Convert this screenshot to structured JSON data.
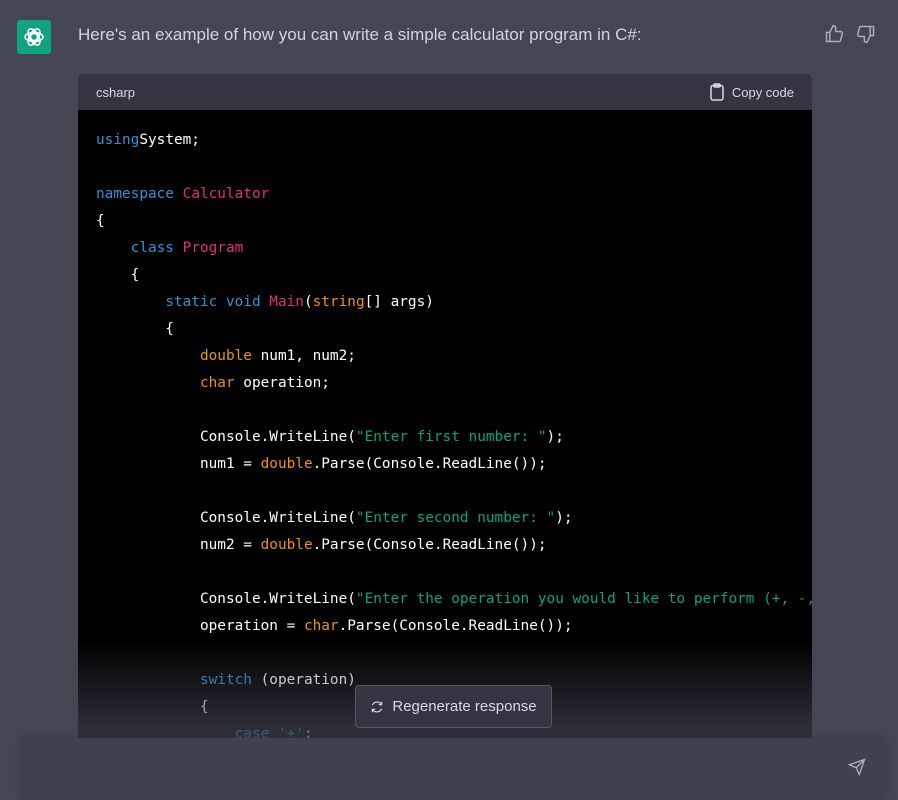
{
  "message": {
    "text": "Here's an example of how you can write a simple calculator program in C#:"
  },
  "code_block": {
    "language": "csharp",
    "copy_label": "Copy code",
    "lines": [
      [
        [
          "k",
          "using"
        ],
        [
          "",
          "System;"
        ]
      ],
      [],
      [
        [
          "k",
          "namespace"
        ],
        [
          "",
          ""
        ],
        [
          "t",
          "Calculator"
        ]
      ],
      [
        [
          "",
          "{"
        ]
      ],
      [
        [
          "",
          "    "
        ],
        [
          "k",
          "class"
        ],
        [
          "",
          ""
        ],
        [
          "t",
          "Program"
        ]
      ],
      [
        [
          "",
          "    {"
        ]
      ],
      [
        [
          "",
          "        "
        ],
        [
          "k",
          "static"
        ],
        [
          "",
          ""
        ],
        [
          "k",
          "void"
        ],
        [
          "",
          ""
        ],
        [
          "t",
          "Main"
        ],
        [
          "",
          "("
        ],
        [
          "o",
          "string"
        ],
        [
          "",
          "[] args)"
        ]
      ],
      [
        [
          "",
          "        {"
        ]
      ],
      [
        [
          "",
          "            "
        ],
        [
          "o",
          "double"
        ],
        [
          "",
          ""
        ],
        [
          "",
          "num1, num2;"
        ]
      ],
      [
        [
          "",
          "            "
        ],
        [
          "o",
          "char"
        ],
        [
          "",
          ""
        ],
        [
          "",
          "operation;"
        ]
      ],
      [],
      [
        [
          "",
          "            Console.WriteLine("
        ],
        [
          "s",
          "\"Enter first number: \""
        ],
        [
          "",
          ");"
        ]
      ],
      [
        [
          "",
          "            num1 = "
        ],
        [
          "o",
          "double"
        ],
        [
          "",
          ".Parse(Console.ReadLine());"
        ]
      ],
      [],
      [
        [
          "",
          "            Console.WriteLine("
        ],
        [
          "s",
          "\"Enter second number: \""
        ],
        [
          "",
          ");"
        ]
      ],
      [
        [
          "",
          "            num2 = "
        ],
        [
          "o",
          "double"
        ],
        [
          "",
          ".Parse(Console.ReadLine());"
        ]
      ],
      [],
      [
        [
          "",
          "            Console.WriteLine("
        ],
        [
          "s",
          "\"Enter the operation you would like to perform (+, -, *, /): \""
        ],
        [
          "",
          ");"
        ]
      ],
      [
        [
          "",
          "            operation = "
        ],
        [
          "o",
          "char"
        ],
        [
          "",
          ".Parse(Console.ReadLine());"
        ]
      ],
      [],
      [
        [
          "",
          "            "
        ],
        [
          "k",
          "switch"
        ],
        [
          "",
          ""
        ],
        [
          "",
          "(operation)"
        ]
      ],
      [
        [
          "",
          "            {"
        ]
      ],
      [
        [
          "",
          "                "
        ],
        [
          "k",
          "case"
        ],
        [
          "",
          ""
        ],
        [
          "s",
          "'+'"
        ],
        [
          "",
          ":"
        ]
      ]
    ]
  },
  "regenerate": {
    "label": "Regenerate response"
  },
  "input": {
    "placeholder": "",
    "value": ""
  },
  "colors": {
    "accent": "#10a37f",
    "keyword": "#2e95d3",
    "type": "#df3079",
    "builtin": "#e9950c",
    "string": "#00a67d"
  },
  "icons": [
    "openai-logo-icon",
    "thumbs-up-icon",
    "thumbs-down-icon",
    "clipboard-icon",
    "refresh-icon",
    "send-icon"
  ]
}
